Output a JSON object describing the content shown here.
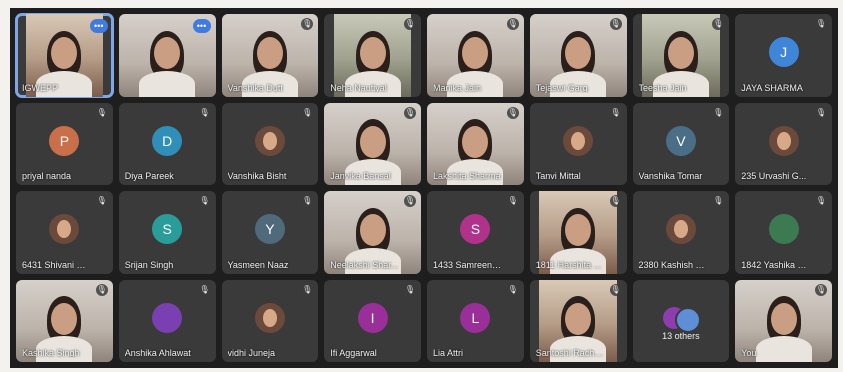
{
  "call": {
    "participants": [
      {
        "name": "IGWEPP",
        "kind": "video",
        "style": "warm",
        "control": "more",
        "active": true
      },
      {
        "name": "",
        "kind": "video",
        "style": "wide",
        "control": "more"
      },
      {
        "name": "Vanshika Dutt",
        "kind": "video",
        "style": "wide",
        "control": "mic"
      },
      {
        "name": "Neha Nautiyal",
        "kind": "video",
        "style": "green",
        "control": "mic"
      },
      {
        "name": "Manika Jain",
        "kind": "video",
        "style": "wide",
        "control": "mic"
      },
      {
        "name": "Tejaswi Garg",
        "kind": "video",
        "style": "wide",
        "control": "mic"
      },
      {
        "name": "Teesha Jain",
        "kind": "video",
        "style": "green",
        "control": "mic"
      },
      {
        "name": "JAYA SHARMA",
        "kind": "avatar",
        "initial": "J",
        "color": "#3f86d8",
        "control": "mic"
      },
      {
        "name": "priyal nanda",
        "kind": "avatar",
        "initial": "P",
        "color": "#c96f4a",
        "control": "mic"
      },
      {
        "name": "Diya Pareek",
        "kind": "avatar",
        "initial": "D",
        "color": "#2f8fb8",
        "control": "mic"
      },
      {
        "name": "Vanshika Bisht",
        "kind": "avatar-photo",
        "control": "mic"
      },
      {
        "name": "Janvika Bansal",
        "kind": "video",
        "style": "wide",
        "control": "mic"
      },
      {
        "name": "Lakshita Sharma",
        "kind": "video",
        "style": "wide",
        "control": "mic"
      },
      {
        "name": "Tanvi Mittal",
        "kind": "avatar-photo",
        "control": "mic"
      },
      {
        "name": "Vanshika Tomar",
        "kind": "avatar",
        "initial": "V",
        "color": "#4a6e86",
        "control": "mic"
      },
      {
        "name": "235 Urvashi G...",
        "kind": "avatar-photo",
        "control": "mic"
      },
      {
        "name": "6431 Shivani Si...",
        "kind": "avatar-photo",
        "control": "mic"
      },
      {
        "name": "Srijan Singh",
        "kind": "avatar",
        "initial": "S",
        "color": "#2a9d9a",
        "control": "mic"
      },
      {
        "name": "Yasmeen Naaz",
        "kind": "avatar",
        "initial": "Y",
        "color": "#4f6a7a",
        "control": "mic"
      },
      {
        "name": "Neelakshi Shar...",
        "kind": "video",
        "style": "wide",
        "control": "mic"
      },
      {
        "name": "1433 Samreen ...",
        "kind": "avatar",
        "initial": "S",
        "color": "#b0328a",
        "control": "mic"
      },
      {
        "name": "1811 Harshita ...",
        "kind": "video",
        "style": "warm",
        "control": "mic"
      },
      {
        "name": "2380 Kashish C...",
        "kind": "avatar-photo",
        "control": "mic"
      },
      {
        "name": "1842 Yashika R...",
        "kind": "avatar",
        "initial": "",
        "color": "#3c7a52",
        "control": "mic"
      },
      {
        "name": "Kashika Singh",
        "kind": "video",
        "style": "wide",
        "control": "mic"
      },
      {
        "name": "Anshika Ahlawat",
        "kind": "avatar",
        "initial": "",
        "color": "#7a3fb0",
        "control": "mic"
      },
      {
        "name": "vidhi Juneja",
        "kind": "avatar-photo",
        "control": "mic"
      },
      {
        "name": "Ifi Aggarwal",
        "kind": "avatar",
        "initial": "I",
        "color": "#9b2f9a",
        "control": "mic"
      },
      {
        "name": "Lia Attri",
        "kind": "avatar",
        "initial": "L",
        "color": "#9b2f9a",
        "control": "mic"
      },
      {
        "name": "Santoshi Rachael",
        "kind": "video",
        "style": "warm",
        "control": "mic"
      },
      {
        "name": "others",
        "kind": "others",
        "count_label": "13 others",
        "control": "none"
      },
      {
        "name": "You",
        "kind": "video",
        "style": "wide",
        "control": "mic"
      }
    ]
  },
  "icons": {
    "mic_off": "mic-off-icon",
    "more": "more-options-icon"
  },
  "colors": {
    "active_outline": "#7fa6e6",
    "tile": "#3a3a3a",
    "background": "#1f1e1e"
  }
}
